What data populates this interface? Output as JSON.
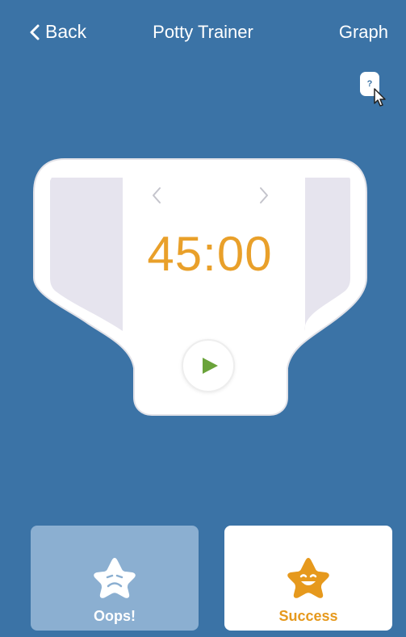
{
  "nav": {
    "back_label": "Back",
    "title": "Potty Trainer",
    "graph_label": "Graph"
  },
  "help": {
    "label": "?"
  },
  "timer": {
    "display": "45:00"
  },
  "actions": {
    "oops_label": "Oops!",
    "success_label": "Success"
  },
  "colors": {
    "background": "#3b73a6",
    "timer": "#e9a02a",
    "play": "#6aa33a",
    "oops_card": "#8bafd1",
    "success_star": "#e6991d"
  }
}
